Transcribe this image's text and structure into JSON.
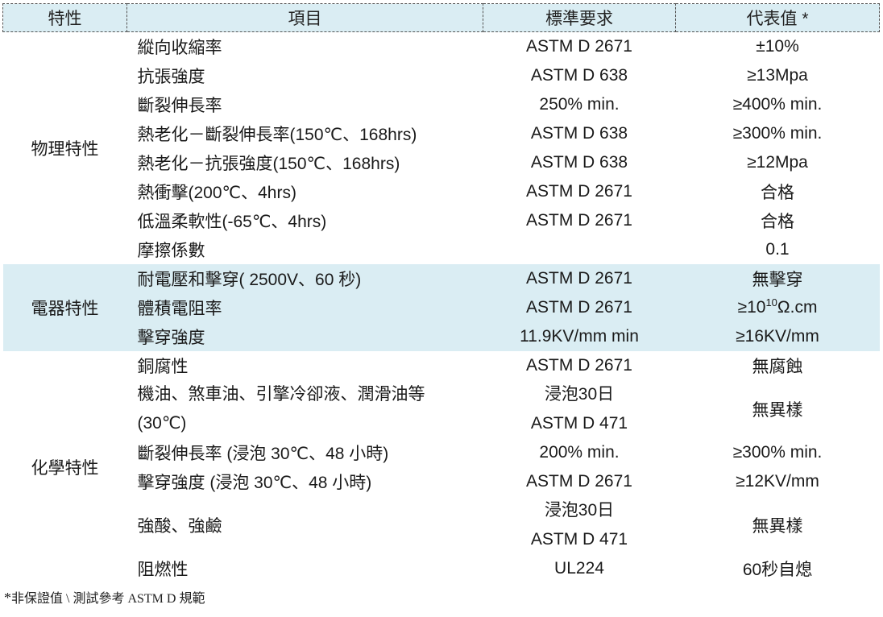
{
  "header": [
    "特性",
    "項目",
    "標準要求",
    "代表值 *"
  ],
  "groups": {
    "physical": "物理特性",
    "electrical": "電器特性",
    "chemical": "化學特性"
  },
  "rows": [
    {
      "item": "縱向收縮率",
      "std": "ASTM D 2671",
      "val": "±10%"
    },
    {
      "item": "抗張強度",
      "std": "ASTM D 638",
      "val": "≥13Mpa"
    },
    {
      "item": "斷裂伸長率",
      "std": "250% min.",
      "val": "≥400% min."
    },
    {
      "item": "熱老化－斷裂伸長率(150℃、168hrs)",
      "std": "ASTM D 638",
      "val": "≥300% min."
    },
    {
      "item": "熱老化－抗張強度(150℃、168hrs)",
      "std": "ASTM D 638",
      "val": "≥12Mpa"
    },
    {
      "item": "熱衝擊(200℃、4hrs)",
      "std": "ASTM D 2671",
      "val": "合格"
    },
    {
      "item": "低溫柔軟性(-65℃、4hrs)",
      "std": "ASTM D 2671",
      "val": "合格"
    },
    {
      "item": "摩擦係數",
      "std": "",
      "val": "0.1"
    },
    {
      "item": "耐電壓和擊穿( 2500V、60  秒)",
      "std": "ASTM D 2671",
      "val": "無擊穿"
    },
    {
      "item": "體積電阻率",
      "std": "ASTM D 2671",
      "val_pre": "≥10",
      "val_sup": "10",
      "val_post": "Ω.cm"
    },
    {
      "item": "擊穿強度",
      "std": "11.9KV/mm min",
      "val": "≥16KV/mm"
    },
    {
      "item": "銅腐性",
      "std": "ASTM D 2671",
      "val": "無腐蝕"
    },
    {
      "item_l1": "機油、煞車油、引擎冷卻液、潤滑油等",
      "item_l2": "(30℃)",
      "std_l1": "浸泡30日",
      "std_l2": "ASTM D 471",
      "val": "無異樣"
    },
    {
      "item": "斷裂伸長率 (浸泡 30℃、48 小時)",
      "std": "200% min.",
      "val": "≥300% min."
    },
    {
      "item": "擊穿強度 (浸泡 30℃、48 小時)",
      "std": "ASTM D 2671",
      "val": "≥12KV/mm"
    },
    {
      "item": "強酸、強鹼",
      "std_l1": "浸泡30日",
      "std_l2": "ASTM D 471",
      "val": "無異樣"
    },
    {
      "item": "阻燃性",
      "std": "UL224",
      "val": "60秒自熄"
    }
  ],
  "footnote": {
    "star": "*",
    "text": "非保證值 \\ 測試參考 ASTM D 規範"
  }
}
